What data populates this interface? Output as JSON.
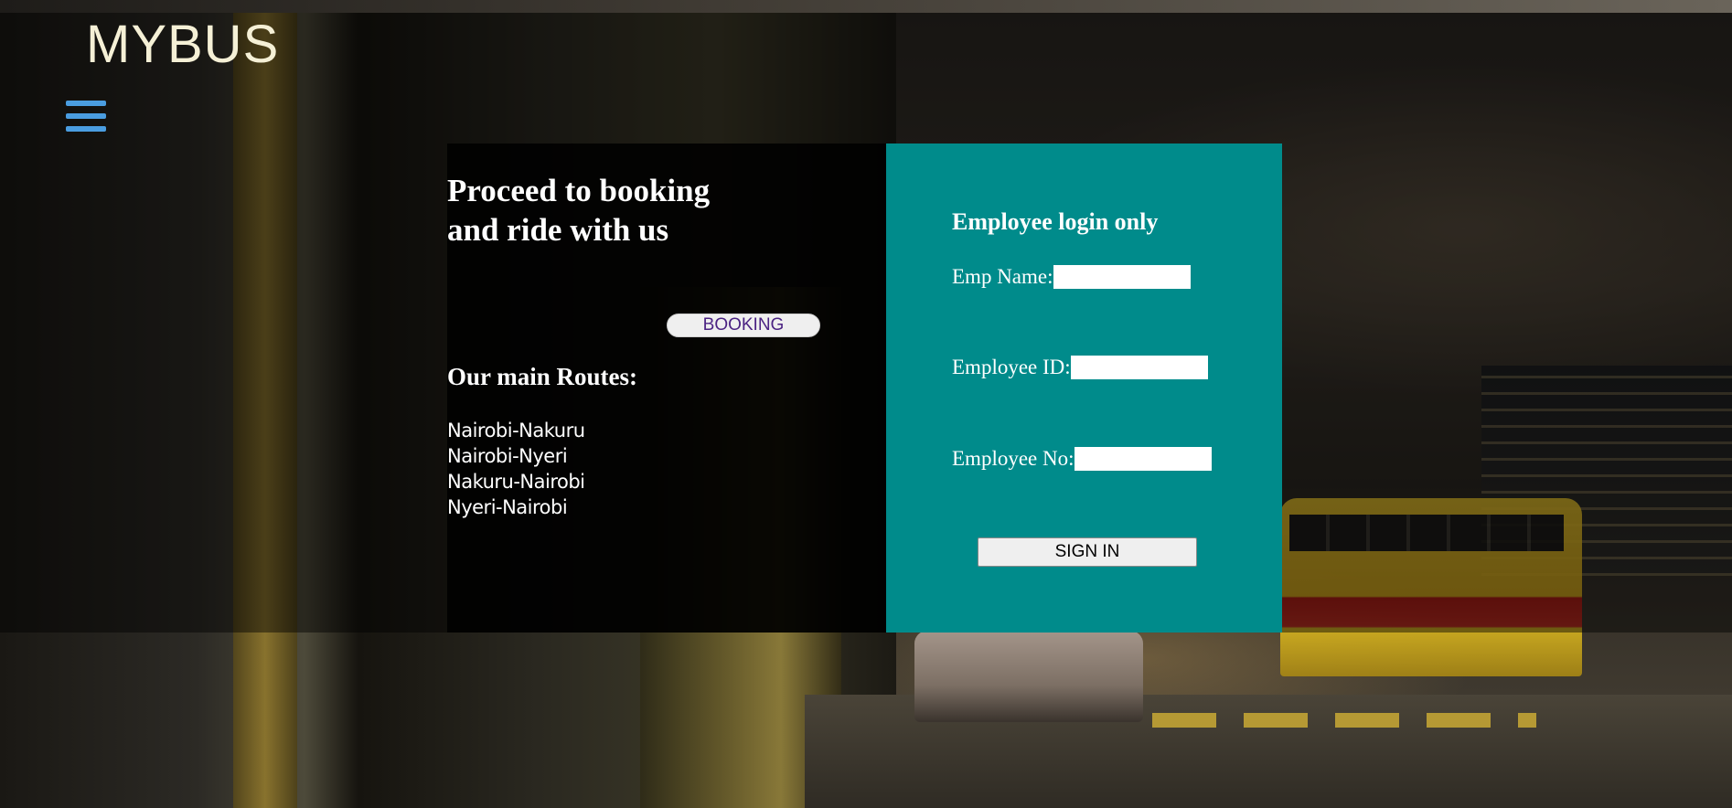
{
  "brand": {
    "name": "MYBUS"
  },
  "booking": {
    "title_line1": "Proceed to booking",
    "title_line2": "and ride with us",
    "button_label": "BOOKING",
    "routes_title": "Our main Routes:",
    "routes": [
      "Nairobi-Nakuru",
      "Nairobi-Nyeri",
      "Nakuru-Nairobi",
      "Nyeri-Nairobi"
    ]
  },
  "login": {
    "title": "Employee login only",
    "fields": [
      {
        "label": "Emp Name:",
        "value": ""
      },
      {
        "label": "Employee ID:",
        "value": ""
      },
      {
        "label": "Employee No:",
        "value": ""
      }
    ],
    "submit_label": "SIGN IN"
  },
  "colors": {
    "brand_text": "#f5f0d6",
    "menu_icon": "#4a9de0",
    "login_panel": "#008b8b",
    "booking_button_text": "#4b2383"
  },
  "icons": {
    "menu": "hamburger-menu-icon"
  }
}
